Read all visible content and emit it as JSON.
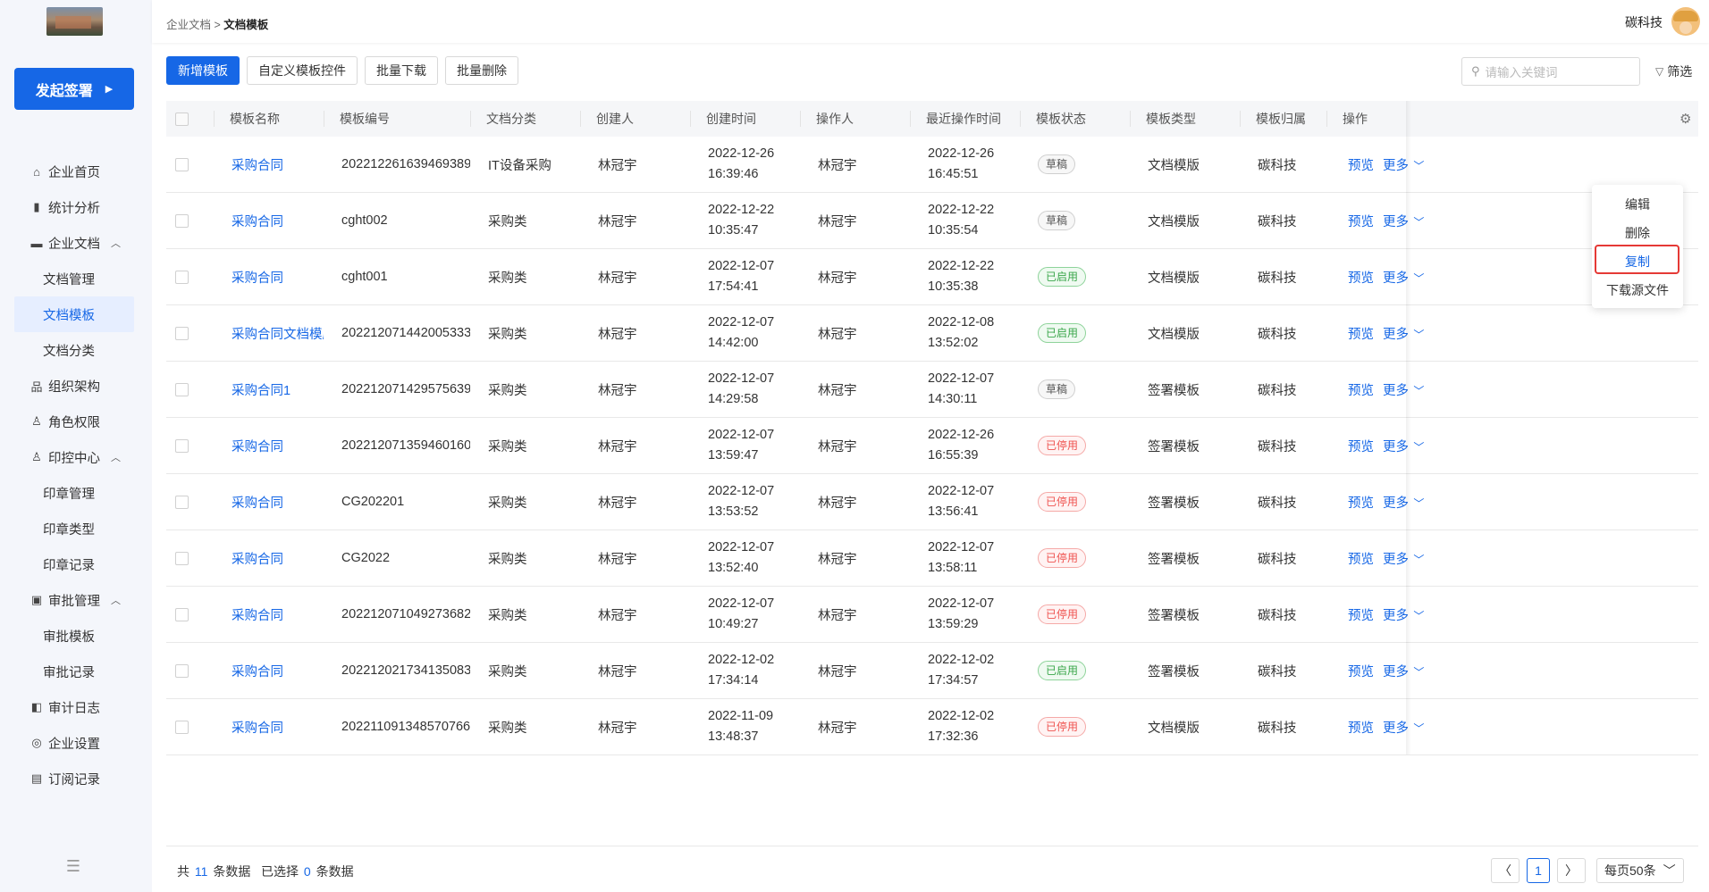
{
  "sidebar": {
    "sign_button": "发起签署",
    "menu": [
      {
        "type": "item",
        "icon": "home-icon",
        "glyph": "⌂",
        "label": "企业首页"
      },
      {
        "type": "item",
        "icon": "stats-icon",
        "glyph": "▮",
        "label": "统计分析"
      },
      {
        "type": "item",
        "icon": "folder-icon",
        "glyph": "▬",
        "label": "企业文档",
        "caret": "︿"
      },
      {
        "type": "sub",
        "label": "文档管理"
      },
      {
        "type": "sub",
        "label": "文档模板",
        "active": true
      },
      {
        "type": "sub",
        "label": "文档分类"
      },
      {
        "type": "item",
        "icon": "org-icon",
        "glyph": "品",
        "label": "组织架构"
      },
      {
        "type": "item",
        "icon": "role-icon",
        "glyph": "♙",
        "label": "角色权限"
      },
      {
        "type": "item",
        "icon": "seal-icon",
        "glyph": "♙",
        "label": "印控中心",
        "caret": "︿"
      },
      {
        "type": "sub",
        "label": "印章管理"
      },
      {
        "type": "sub",
        "label": "印章类型"
      },
      {
        "type": "sub",
        "label": "印章记录"
      },
      {
        "type": "item",
        "icon": "approval-icon",
        "glyph": "▣",
        "label": "审批管理",
        "caret": "︿"
      },
      {
        "type": "sub",
        "label": "审批模板"
      },
      {
        "type": "sub",
        "label": "审批记录"
      },
      {
        "type": "item",
        "icon": "log-icon",
        "glyph": "◧",
        "label": "审计日志"
      },
      {
        "type": "item",
        "icon": "settings-icon",
        "glyph": "◎",
        "label": "企业设置"
      },
      {
        "type": "item",
        "icon": "subscription-icon",
        "glyph": "▤",
        "label": "订阅记录"
      }
    ]
  },
  "header": {
    "breadcrumb_parent": "企业文档",
    "breadcrumb_sep": ">",
    "breadcrumb_current": "文档模板",
    "user_name": "碳科技"
  },
  "toolbar": {
    "add_template": "新增模板",
    "custom_controls": "自定义模板控件",
    "batch_download": "批量下载",
    "batch_delete": "批量删除",
    "search_placeholder": "请输入关键词",
    "filter": "筛选"
  },
  "table": {
    "headers": [
      "模板名称",
      "模板编号",
      "文档分类",
      "创建人",
      "创建时间",
      "操作人",
      "最近操作时间",
      "模板状态",
      "模板类型",
      "模板归属",
      "操作"
    ],
    "op_preview": "预览",
    "op_more": "更多",
    "rows": [
      {
        "name": "采购合同",
        "code": "202212261639469389",
        "category": "IT设备采购",
        "creator": "林冠宇",
        "created_date": "2022-12-26",
        "created_time": "16:39:46",
        "operator": "林冠宇",
        "op_date": "2022-12-26",
        "op_time": "16:45:51",
        "status": "草稿",
        "status_kind": "draft",
        "type": "文档模版",
        "owner": "碳科技"
      },
      {
        "name": "采购合同",
        "code": "cght002",
        "category": "采购类",
        "creator": "林冠宇",
        "created_date": "2022-12-22",
        "created_time": "10:35:47",
        "operator": "林冠宇",
        "op_date": "2022-12-22",
        "op_time": "10:35:54",
        "status": "草稿",
        "status_kind": "draft",
        "type": "文档模版",
        "owner": "碳科技"
      },
      {
        "name": "采购合同",
        "code": "cght001",
        "category": "采购类",
        "creator": "林冠宇",
        "created_date": "2022-12-07",
        "created_time": "17:54:41",
        "operator": "林冠宇",
        "op_date": "2022-12-22",
        "op_time": "10:35:38",
        "status": "已启用",
        "status_kind": "on",
        "type": "文档模版",
        "owner": "碳科技"
      },
      {
        "name": "采购合同文档模版",
        "code": "202212071442005333",
        "category": "采购类",
        "creator": "林冠宇",
        "created_date": "2022-12-07",
        "created_time": "14:42:00",
        "operator": "林冠宇",
        "op_date": "2022-12-08",
        "op_time": "13:52:02",
        "status": "已启用",
        "status_kind": "on",
        "type": "文档模版",
        "owner": "碳科技"
      },
      {
        "name": "采购合同1",
        "code": "202212071429575639",
        "category": "采购类",
        "creator": "林冠宇",
        "created_date": "2022-12-07",
        "created_time": "14:29:58",
        "operator": "林冠宇",
        "op_date": "2022-12-07",
        "op_time": "14:30:11",
        "status": "草稿",
        "status_kind": "draft",
        "type": "签署模板",
        "owner": "碳科技"
      },
      {
        "name": "采购合同",
        "code": "202212071359460160",
        "category": "采购类",
        "creator": "林冠宇",
        "created_date": "2022-12-07",
        "created_time": "13:59:47",
        "operator": "林冠宇",
        "op_date": "2022-12-26",
        "op_time": "16:55:39",
        "status": "已停用",
        "status_kind": "off",
        "type": "签署模板",
        "owner": "碳科技"
      },
      {
        "name": "采购合同",
        "code": "CG202201",
        "category": "采购类",
        "creator": "林冠宇",
        "created_date": "2022-12-07",
        "created_time": "13:53:52",
        "operator": "林冠宇",
        "op_date": "2022-12-07",
        "op_time": "13:56:41",
        "status": "已停用",
        "status_kind": "off",
        "type": "签署模板",
        "owner": "碳科技"
      },
      {
        "name": "采购合同",
        "code": "CG2022",
        "category": "采购类",
        "creator": "林冠宇",
        "created_date": "2022-12-07",
        "created_time": "13:52:40",
        "operator": "林冠宇",
        "op_date": "2022-12-07",
        "op_time": "13:58:11",
        "status": "已停用",
        "status_kind": "off",
        "type": "签署模板",
        "owner": "碳科技"
      },
      {
        "name": "采购合同",
        "code": "202212071049273682",
        "category": "采购类",
        "creator": "林冠宇",
        "created_date": "2022-12-07",
        "created_time": "10:49:27",
        "operator": "林冠宇",
        "op_date": "2022-12-07",
        "op_time": "13:59:29",
        "status": "已停用",
        "status_kind": "off",
        "type": "签署模板",
        "owner": "碳科技"
      },
      {
        "name": "采购合同",
        "code": "202212021734135083",
        "category": "采购类",
        "creator": "林冠宇",
        "created_date": "2022-12-02",
        "created_time": "17:34:14",
        "operator": "林冠宇",
        "op_date": "2022-12-02",
        "op_time": "17:34:57",
        "status": "已启用",
        "status_kind": "on",
        "type": "签署模板",
        "owner": "碳科技"
      },
      {
        "name": "采购合同",
        "code": "202211091348570766",
        "category": "采购类",
        "creator": "林冠宇",
        "created_date": "2022-11-09",
        "created_time": "13:48:37",
        "operator": "林冠宇",
        "op_date": "2022-12-02",
        "op_time": "17:32:36",
        "status": "已停用",
        "status_kind": "off",
        "type": "文档模版",
        "owner": "碳科技"
      }
    ]
  },
  "dropdown": {
    "items": [
      "编辑",
      "删除",
      "复制",
      "下载源文件"
    ],
    "highlighted": "复制"
  },
  "footer": {
    "total_prefix": "共",
    "total": "11",
    "total_suffix": "条数据",
    "selected_prefix": "已选择",
    "selected": "0",
    "selected_suffix": "条数据",
    "current_page": "1",
    "page_size": "每页50条"
  }
}
